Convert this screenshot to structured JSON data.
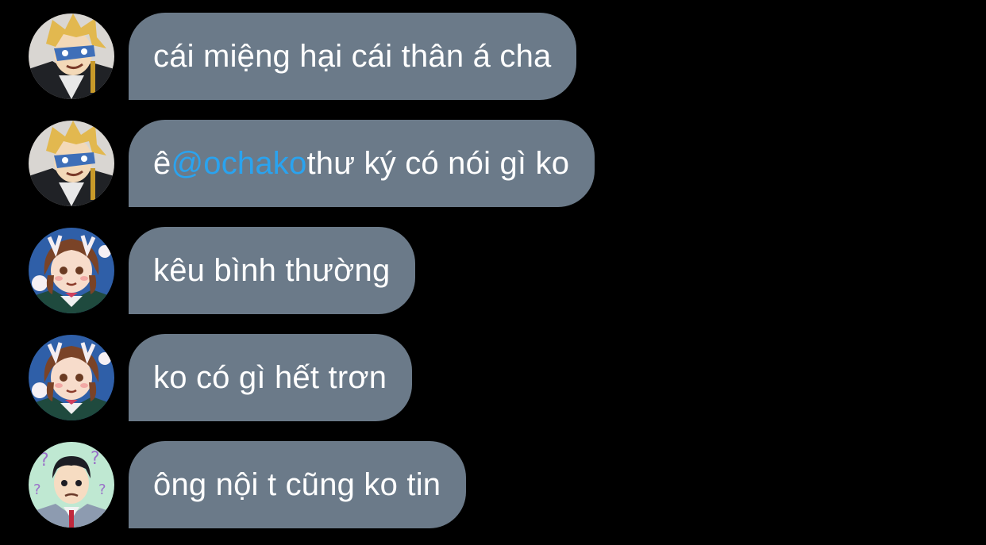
{
  "colors": {
    "background": "#000000",
    "bubble": "#6b7a89",
    "text": "#ffffff",
    "mention": "#2aa3ef"
  },
  "messages": [
    {
      "avatar": "blonde-boy-avatar",
      "text": "cái miệng hại cái thân á cha"
    },
    {
      "avatar": "blonde-boy-avatar",
      "prefix": "ê ",
      "mention": "@ochako",
      "suffix": " thư ký có nói gì ko"
    },
    {
      "avatar": "brown-hair-girl-avatar",
      "text": "kêu bình thường"
    },
    {
      "avatar": "brown-hair-girl-avatar",
      "text": "ko có gì hết trơn"
    },
    {
      "avatar": "black-hair-boy-avatar",
      "text": "ông nội t cũng ko tin"
    }
  ]
}
